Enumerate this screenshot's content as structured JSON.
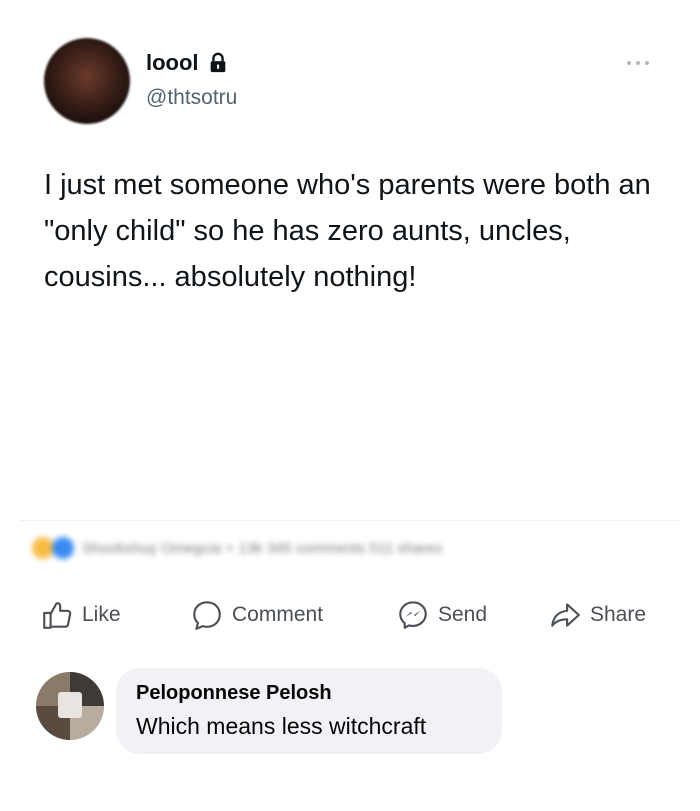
{
  "tweet": {
    "display_name": "loool",
    "handle": "@thtsotru",
    "text": "I just met someone who's parents were both an \"only child\" so he has zero aunts, uncles, cousins... absolutely nothing!",
    "icons": {
      "lock": "lock-icon",
      "more": "more-icon"
    }
  },
  "facebook_post": {
    "reactions_summary": "Shoobshuy Omegcia + 13k   345 comments   511 shares",
    "actions": [
      {
        "label": "Like",
        "icon": "thumbs-up-icon"
      },
      {
        "label": "Comment",
        "icon": "comment-icon"
      },
      {
        "label": "Send",
        "icon": "messenger-icon"
      },
      {
        "label": "Share",
        "icon": "share-icon"
      }
    ],
    "comment": {
      "author": "Peloponnese Pelosh",
      "text": "Which means less witchcraft"
    }
  },
  "colors": {
    "text_primary": "#0f1419",
    "text_secondary": "#536471",
    "action_gray": "#4b4f56",
    "bubble_bg": "#f0f2f5",
    "like_blue": "#1877f2"
  }
}
